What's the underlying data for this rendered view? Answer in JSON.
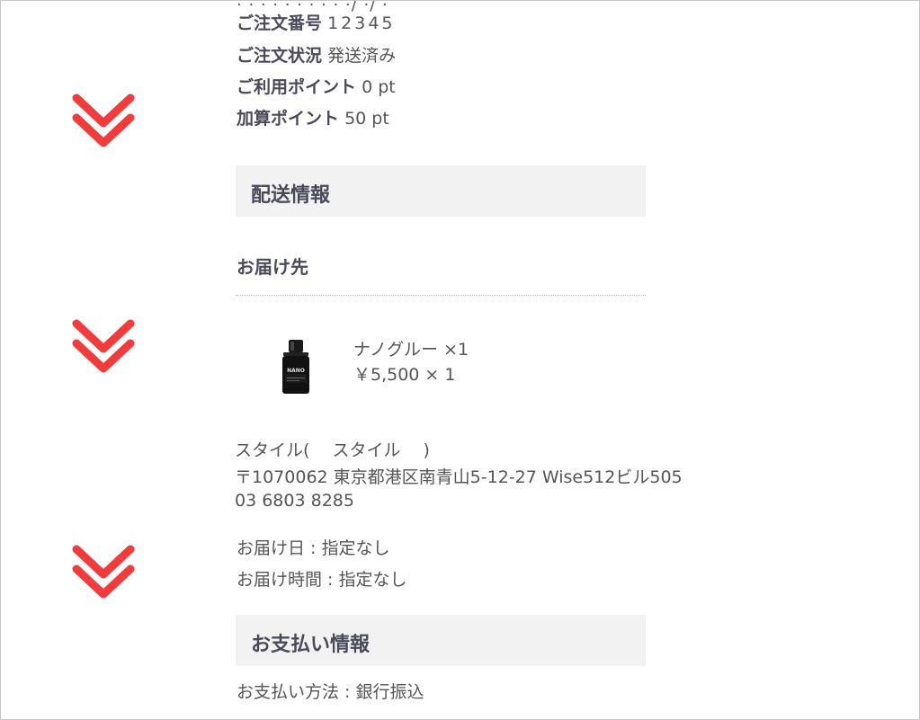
{
  "order": {
    "number_label": "ご注文番号",
    "number_value": "12345",
    "status_label": "ご注文状況",
    "status_value": "発送済み",
    "used_points_label": "ご利用ポイント",
    "used_points_value": "0 pt",
    "added_points_label": "加算ポイント",
    "added_points_value": "50 pt"
  },
  "shipping": {
    "section_title": "配送情報",
    "destination_heading": "お届け先",
    "product": {
      "name": "ナノグルー ×1",
      "price": "￥5,500 × 1",
      "image_text": "NANO"
    },
    "recipient": "スタイル(　 スタイル　 )",
    "address": "〒1070062 東京都港区南青山5-12-27 Wise512ビル505",
    "phone": "03 6803 8285",
    "delivery_date": "お届け日 : 指定なし",
    "delivery_time": "お届け時間 : 指定なし"
  },
  "payment": {
    "section_title": "お支払い情報",
    "method": "お支払い方法 : 銀行振込"
  },
  "icons": {
    "chevron": "double-chevron-down-icon",
    "chevron_color": "#f23b3b"
  }
}
